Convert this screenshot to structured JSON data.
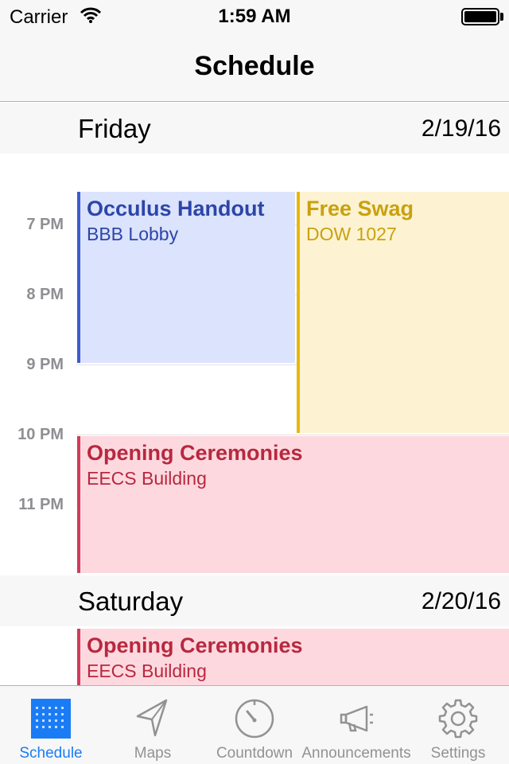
{
  "status_bar": {
    "carrier": "Carrier",
    "time": "1:59 AM"
  },
  "nav": {
    "title": "Schedule"
  },
  "days": [
    {
      "name": "Friday",
      "date": "2/19/16"
    },
    {
      "name": "Saturday",
      "date": "2/20/16"
    }
  ],
  "time_labels": [
    "7 PM",
    "8 PM",
    "9 PM",
    "10 PM",
    "11 PM"
  ],
  "events": {
    "friday": [
      {
        "title": "Occulus Handout",
        "location": "BBB Lobby"
      },
      {
        "title": "Free Swag",
        "location": "DOW 1027"
      },
      {
        "title": "Opening Ceremonies",
        "location": "EECS Building"
      }
    ],
    "saturday": [
      {
        "title": "Opening Ceremonies",
        "location": "EECS Building"
      }
    ]
  },
  "colors": {
    "accent": "#1a7cf5",
    "event_blue": "#3f5bd0",
    "event_yellow": "#e8b80a",
    "event_red": "#d23c5b"
  },
  "tabs": [
    {
      "label": "Schedule",
      "icon": "calendar-grid-icon",
      "active": true
    },
    {
      "label": "Maps",
      "icon": "location-arrow-icon",
      "active": false
    },
    {
      "label": "Countdown",
      "icon": "timer-icon",
      "active": false
    },
    {
      "label": "Announcements",
      "icon": "megaphone-icon",
      "active": false
    },
    {
      "label": "Settings",
      "icon": "gear-icon",
      "active": false
    }
  ]
}
